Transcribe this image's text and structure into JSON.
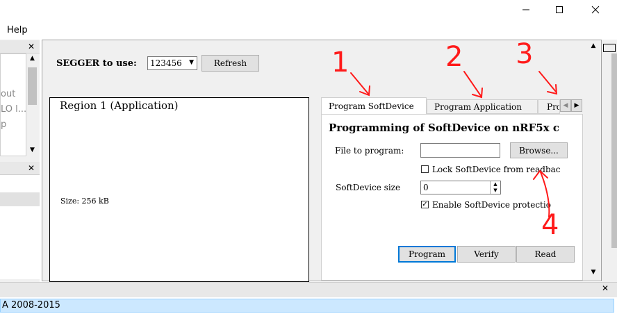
{
  "window": {
    "controls": [
      "minimize-icon",
      "maximize-icon",
      "close-icon"
    ]
  },
  "menubar": {
    "help": "Help"
  },
  "left_panel": {
    "list_items": [
      "out",
      "LO l...",
      "p"
    ]
  },
  "status": {
    "copyright": "A 2008-2015"
  },
  "segger": {
    "label": "SEGGER to use:",
    "selected": "123456",
    "refresh": "Refresh"
  },
  "region": {
    "title": "Region 1 (Application)",
    "size": "Size: 256 kB"
  },
  "tabs": [
    {
      "label": "Program SoftDevice"
    },
    {
      "label": "Program Application"
    },
    {
      "label": "Pro"
    }
  ],
  "softdevice": {
    "heading": "Programming of SoftDevice on nRF5x c",
    "file_label": "File to program:",
    "file_value": "",
    "browse": "Browse...",
    "lock_label": "Lock SoftDevice from readbac",
    "lock_checked": false,
    "size_label": "SoftDevice size",
    "size_value": "0",
    "protect_label": "Enable SoftDevice protectio",
    "protect_checked": true,
    "program": "Program",
    "verify": "Verify",
    "read": "Read"
  },
  "annotations": [
    "1",
    "2",
    "3",
    "4"
  ],
  "colors": {
    "annotation": "#ff1a1a",
    "selection": "#cce8ff",
    "accent": "#0078d7"
  }
}
